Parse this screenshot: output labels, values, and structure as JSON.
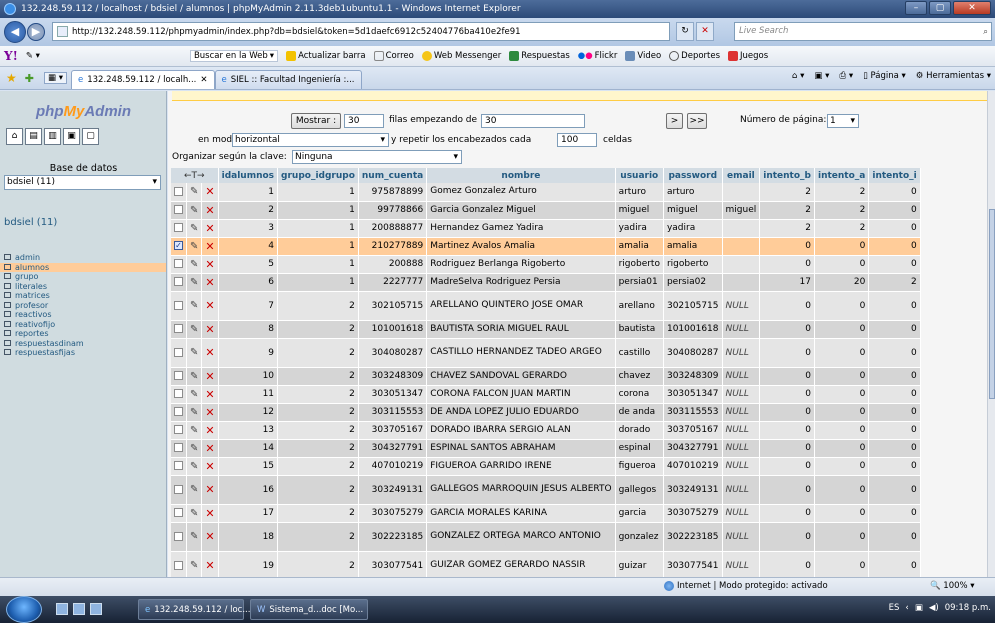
{
  "window": {
    "title": "132.248.59.112 / localhost / bdsiel / alumnos | phpMyAdmin 2.11.3deb1ubuntu1.1 - Windows Internet Explorer",
    "minimize": "–",
    "maximize": "▢",
    "close": "✕"
  },
  "address_bar": {
    "url": "http://132.248.59.112/phpmyadmin/index.php?db=bdsiel&token=5d1daefc6912c52404776ba410e2fe91",
    "search_placeholder": "Live Search"
  },
  "yahoo_toolbar": {
    "logo": "Y!",
    "search_label": "Buscar en la Web",
    "items": [
      "Actualizar barra",
      "Correo",
      "Web Messenger",
      "Respuestas",
      "Flickr",
      "Video",
      "Deportes",
      "Juegos"
    ]
  },
  "tabs": [
    {
      "label": "132.248.59.112 / localh...",
      "close": "✕"
    },
    {
      "label": "SIEL :: Facultad Ingeniería :..."
    }
  ],
  "tab_tools": {
    "page_label": "Página",
    "tools_label": "Herramientas"
  },
  "sidebar": {
    "logo_php": "php",
    "logo_my": "My",
    "logo_admin": "Admin",
    "db_label": "Base de datos",
    "db_select": "bdsiel (11)",
    "db_name": "bdsiel (11)",
    "tables": [
      "admin",
      "alumnos",
      "grupo",
      "literales",
      "matrices",
      "profesor",
      "reactivos",
      "reativofijo",
      "reportes",
      "respuestasdinam",
      "respuestasfijas"
    ],
    "selected_table": "alumnos"
  },
  "controls": {
    "mostrar_button": "Mostrar :",
    "rows_value": "30",
    "filas_label": "filas empezando de",
    "start_value": "30",
    "next_button": ">",
    "last_button": ">>",
    "page_label": "Número de página:",
    "page_value": "1",
    "mode_label": "en modo",
    "mode_value": "horizontal",
    "repeat_label": "y repetir los encabezados cada",
    "repeat_value": "100",
    "celdas_label": "celdas",
    "sort_label": "Organizar según la clave:",
    "sort_value": "Ninguna"
  },
  "table": {
    "arrows": "←T→",
    "columns": [
      "idalumnos",
      "grupo_idgrupo",
      "num_cuenta",
      "nombre",
      "usuario",
      "password",
      "email",
      "intento_b",
      "intento_a",
      "intento_i"
    ],
    "rows": [
      {
        "idalumnos": "1",
        "grupo_idgrupo": "1",
        "num_cuenta": "975878899",
        "nombre": "Gomez Gonzalez Arturo",
        "usuario": "arturo",
        "password": "arturo",
        "email": "",
        "intento_b": "2",
        "intento_a": "2",
        "intento_i": "0"
      },
      {
        "idalumnos": "2",
        "grupo_idgrupo": "1",
        "num_cuenta": "99778866",
        "nombre": "Garcia Gonzalez Miguel",
        "usuario": "miguel",
        "password": "miguel",
        "email": "miguel",
        "intento_b": "2",
        "intento_a": "2",
        "intento_i": "0"
      },
      {
        "idalumnos": "3",
        "grupo_idgrupo": "1",
        "num_cuenta": "200888877",
        "nombre": "Hernandez Gamez Yadira",
        "usuario": "yadira",
        "password": "yadira",
        "email": "",
        "intento_b": "2",
        "intento_a": "2",
        "intento_i": "0"
      },
      {
        "idalumnos": "4",
        "grupo_idgrupo": "1",
        "num_cuenta": "210277889",
        "nombre": "Martinez Avalos Amalia",
        "usuario": "amalia",
        "password": "amalia",
        "email": "",
        "intento_b": "0",
        "intento_a": "0",
        "intento_i": "0",
        "marked": true
      },
      {
        "idalumnos": "5",
        "grupo_idgrupo": "1",
        "num_cuenta": "200888",
        "nombre": "Rodriguez Berlanga Rigoberto",
        "usuario": "rigoberto",
        "password": "rigoberto",
        "email": "",
        "intento_b": "0",
        "intento_a": "0",
        "intento_i": "0"
      },
      {
        "idalumnos": "6",
        "grupo_idgrupo": "1",
        "num_cuenta": "2227777",
        "nombre": "MadreSelva Rodriguez Persia",
        "usuario": "persia01",
        "password": "persia02",
        "email": "",
        "intento_b": "17",
        "intento_a": "20",
        "intento_i": "2"
      },
      {
        "idalumnos": "7",
        "grupo_idgrupo": "2",
        "num_cuenta": "302105715",
        "nombre": "ARELLANO QUINTERO JOSE OMAR",
        "usuario": "arellano",
        "password": "302105715",
        "email": "NULL",
        "intento_b": "0",
        "intento_a": "0",
        "intento_i": "0",
        "tall": true
      },
      {
        "idalumnos": "8",
        "grupo_idgrupo": "2",
        "num_cuenta": "101001618",
        "nombre": "BAUTISTA SORIA MIGUEL RAUL",
        "usuario": "bautista",
        "password": "101001618",
        "email": "NULL",
        "intento_b": "0",
        "intento_a": "0",
        "intento_i": "0"
      },
      {
        "idalumnos": "9",
        "grupo_idgrupo": "2",
        "num_cuenta": "304080287",
        "nombre": "CASTILLO HERNANDEZ TADEO ARGEO",
        "usuario": "castillo",
        "password": "304080287",
        "email": "NULL",
        "intento_b": "0",
        "intento_a": "0",
        "intento_i": "0",
        "tall": true
      },
      {
        "idalumnos": "10",
        "grupo_idgrupo": "2",
        "num_cuenta": "303248309",
        "nombre": "CHAVEZ SANDOVAL GERARDO",
        "usuario": "chavez",
        "password": "303248309",
        "email": "NULL",
        "intento_b": "0",
        "intento_a": "0",
        "intento_i": "0"
      },
      {
        "idalumnos": "11",
        "grupo_idgrupo": "2",
        "num_cuenta": "303051347",
        "nombre": "CORONA FALCON JUAN MARTIN",
        "usuario": "corona",
        "password": "303051347",
        "email": "NULL",
        "intento_b": "0",
        "intento_a": "0",
        "intento_i": "0"
      },
      {
        "idalumnos": "12",
        "grupo_idgrupo": "2",
        "num_cuenta": "303115553",
        "nombre": "DE ANDA LOPEZ JULIO EDUARDO",
        "usuario": "de anda",
        "password": "303115553",
        "email": "NULL",
        "intento_b": "0",
        "intento_a": "0",
        "intento_i": "0"
      },
      {
        "idalumnos": "13",
        "grupo_idgrupo": "2",
        "num_cuenta": "303705167",
        "nombre": "DORADO IBARRA SERGIO ALAN",
        "usuario": "dorado",
        "password": "303705167",
        "email": "NULL",
        "intento_b": "0",
        "intento_a": "0",
        "intento_i": "0"
      },
      {
        "idalumnos": "14",
        "grupo_idgrupo": "2",
        "num_cuenta": "304327791",
        "nombre": "ESPINAL SANTOS ABRAHAM",
        "usuario": "espinal",
        "password": "304327791",
        "email": "NULL",
        "intento_b": "0",
        "intento_a": "0",
        "intento_i": "0"
      },
      {
        "idalumnos": "15",
        "grupo_idgrupo": "2",
        "num_cuenta": "407010219",
        "nombre": "FIGUEROA GARRIDO IRENE",
        "usuario": "figueroa",
        "password": "407010219",
        "email": "NULL",
        "intento_b": "0",
        "intento_a": "0",
        "intento_i": "0"
      },
      {
        "idalumnos": "16",
        "grupo_idgrupo": "2",
        "num_cuenta": "303249131",
        "nombre": "GALLEGOS MARROQUIN JESUS ALBERTO",
        "usuario": "gallegos",
        "password": "303249131",
        "email": "NULL",
        "intento_b": "0",
        "intento_a": "0",
        "intento_i": "0",
        "tall": true
      },
      {
        "idalumnos": "17",
        "grupo_idgrupo": "2",
        "num_cuenta": "303075279",
        "nombre": "GARCIA MORALES KARINA",
        "usuario": "garcia",
        "password": "303075279",
        "email": "NULL",
        "intento_b": "0",
        "intento_a": "0",
        "intento_i": "0"
      },
      {
        "idalumnos": "18",
        "grupo_idgrupo": "2",
        "num_cuenta": "302223185",
        "nombre": "GONZALEZ ORTEGA MARCO ANTONIO",
        "usuario": "gonzalez",
        "password": "302223185",
        "email": "NULL",
        "intento_b": "0",
        "intento_a": "0",
        "intento_i": "0",
        "tall": true
      },
      {
        "idalumnos": "19",
        "grupo_idgrupo": "2",
        "num_cuenta": "303077541",
        "nombre": "GUIZAR GOMEZ GERARDO NASSIR",
        "usuario": "guizar",
        "password": "303077541",
        "email": "NULL",
        "intento_b": "0",
        "intento_a": "0",
        "intento_i": "0",
        "tall": true
      }
    ]
  },
  "status_bar": {
    "zone": "Internet | Modo protegido: activado",
    "zoom": "100%"
  },
  "taskbar": {
    "buttons": [
      "132.248.59.112 / loc...",
      "Sistema_d...doc [Mo..."
    ],
    "lang": "ES",
    "time": "09:18 p.m."
  },
  "colors": {
    "marked_row": "#ffcc99",
    "header_bg": "#d3dce3",
    "link": "#235a81"
  }
}
